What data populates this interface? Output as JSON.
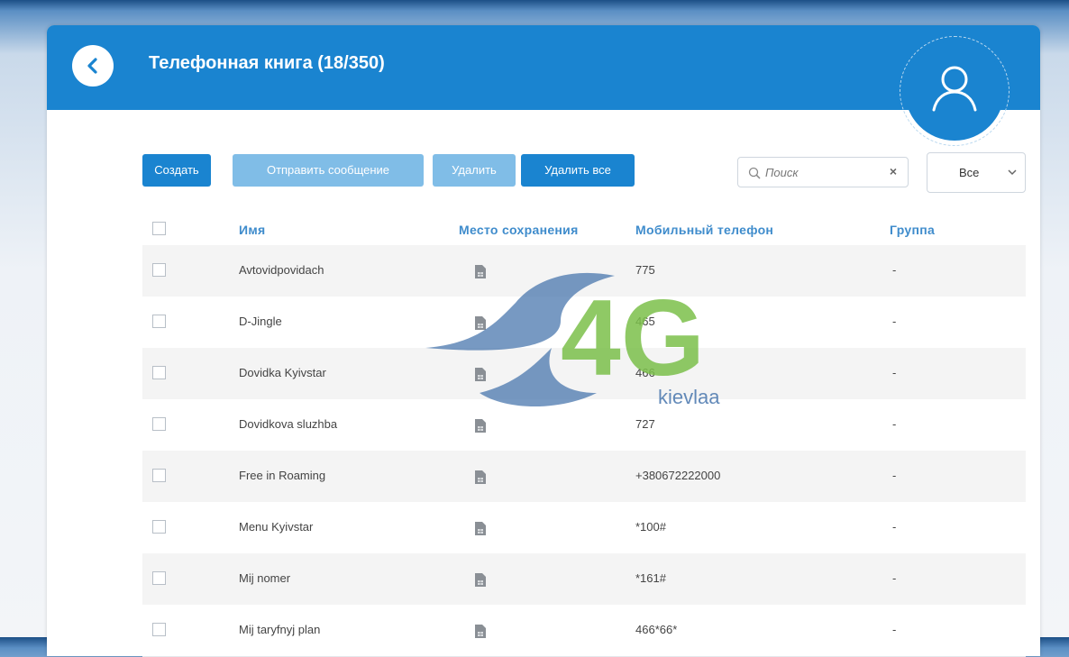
{
  "header": {
    "title": "Телефонная книга (18/350)"
  },
  "toolbar": {
    "create_label": "Создать",
    "send_label": "Отправить сообщение",
    "delete_label": "Удалить",
    "delete_all_label": "Удалить все",
    "search_placeholder": "Поиск",
    "clear_icon": "×",
    "filter_value": "Все"
  },
  "table": {
    "headers": {
      "name": "Имя",
      "storage": "Место сохранения",
      "phone": "Мобильный телефон",
      "group": "Группа"
    },
    "rows": [
      {
        "name": "Avtovidpovidach",
        "storage_icon": "sim-card-icon",
        "phone": "775",
        "group": "-"
      },
      {
        "name": "D-Jingle",
        "storage_icon": "sim-card-icon",
        "phone": "465",
        "group": "-"
      },
      {
        "name": "Dovidka Kyivstar",
        "storage_icon": "sim-card-icon",
        "phone": "466",
        "group": "-"
      },
      {
        "name": "Dovidkova sluzhba",
        "storage_icon": "sim-card-icon",
        "phone": "727",
        "group": "-"
      },
      {
        "name": "Free in Roaming",
        "storage_icon": "sim-card-icon",
        "phone": "+380672222000",
        "group": "-"
      },
      {
        "name": "Menu Kyivstar",
        "storage_icon": "sim-card-icon",
        "phone": "*100#",
        "group": "-"
      },
      {
        "name": "Mij nomer",
        "storage_icon": "sim-card-icon",
        "phone": "*161#",
        "group": "-"
      },
      {
        "name": "Mij taryfnyj plan",
        "storage_icon": "sim-card-icon",
        "phone": "466*66*",
        "group": "-"
      }
    ]
  },
  "watermark": {
    "logo_text": "4G",
    "brand_text": "kievlaa"
  },
  "colors": {
    "primary": "#1a84d0",
    "disabled": "#80bde7",
    "header_text": "#3f8ccc"
  }
}
